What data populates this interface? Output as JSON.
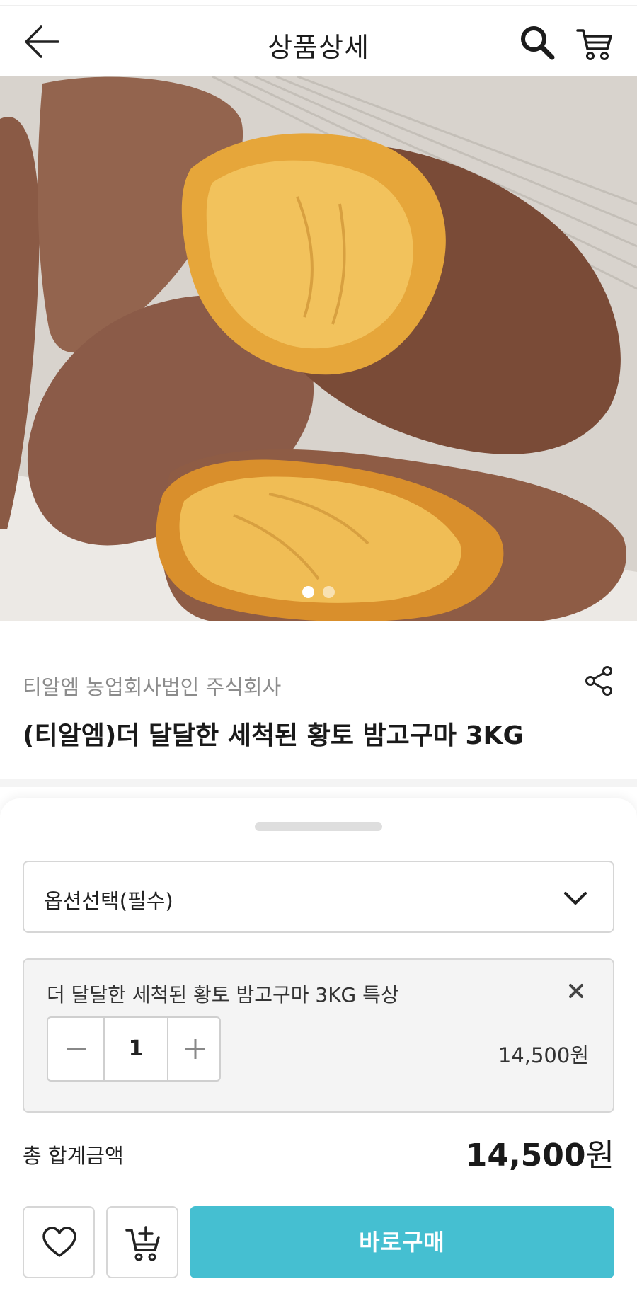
{
  "header": {
    "title": "상품상세",
    "back_icon": "arrow-left-icon",
    "search_icon": "search-icon",
    "cart_icon": "cart-icon"
  },
  "gallery": {
    "image": "baked sweet potatoes photo",
    "slide_count": 2,
    "active_slide": 1
  },
  "product": {
    "seller": "티알엠 농업회사법인 주식회사",
    "name": "(티알엠)더 달달한 세척된 황토 밤고구마 3KG",
    "share_icon": "share-icon"
  },
  "purchase": {
    "select_label": "옵션선택(필수)",
    "selected_option": {
      "name": "더 달달한 세척된 황토 밤고구마 3KG 특상",
      "quantity": "1",
      "price": "14,500원"
    },
    "total_label": "총 합계금액",
    "total_amount": "14,500",
    "total_unit": "원",
    "buy_label": "바로구매"
  },
  "colors": {
    "accent": "#45bfd1",
    "border": "#d6d6d6"
  }
}
